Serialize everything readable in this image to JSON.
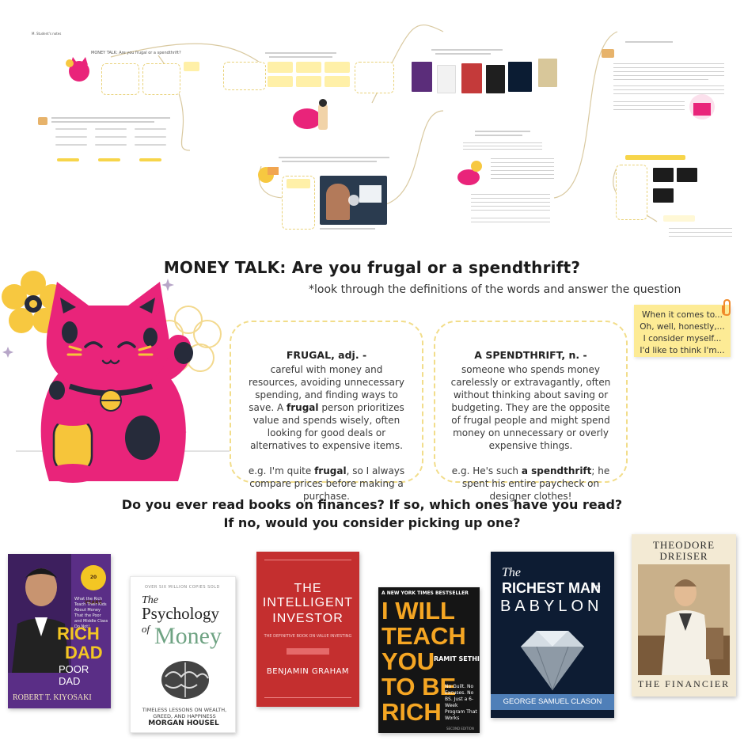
{
  "overview": {
    "header_title": "MONEY TALK: Are you frugal or a spendthrift?",
    "mini_label": "M. Student's notes"
  },
  "main": {
    "title": "MONEY TALK: Are you frugal or a spendthrift?",
    "subtitle": "*look through the definitions of the words and answer the question"
  },
  "definitions": {
    "frugal": {
      "heading": "FRUGAL, adj. -",
      "body_before": "careful with money and resources, avoiding unnecessary spending, and finding ways to save. A ",
      "body_bold": "frugal",
      "body_after": " person prioritizes value and spends wisely, often looking for good deals or alternatives to expensive items.",
      "example_before": "e.g. I'm quite ",
      "example_bold": "frugal",
      "example_after": ", so I always compare prices before making a purchase."
    },
    "spendthrift": {
      "heading": "A SPENDTHRIFT, n. -",
      "body": "someone who spends money carelessly or extravagantly, often without thinking about saving or budgeting. They are the opposite of frugal people and might spend money on unnecessary or overly expensive things.",
      "example_before": "e.g. He's such ",
      "example_bold": "a spendthrift",
      "example_after": "; he spent his entire paycheck on designer clothes!"
    }
  },
  "sticky_note": {
    "lines": [
      "When it comes to...",
      "Oh, well, honestly,...",
      "I consider myself...",
      "I'd like to think I'm..."
    ]
  },
  "question": {
    "line1": "Do you ever read books on finances? If so, which ones have you read?",
    "line2": "If no, would you consider picking up one?"
  },
  "books": [
    {
      "title1": "RICH",
      "title2": "DAD",
      "title3": "POOR DAD",
      "author": "ROBERT T. KIYOSAKI",
      "badge": "20 YEARS",
      "tagline": "What the Rich Teach Their Kids About Money That the Poor and Middle Class Do Not!"
    },
    {
      "kicker": "OVER SIX MILLION COPIES SOLD",
      "title1": "The",
      "title2": "Psychology",
      "title3": "of",
      "title4": "Money",
      "tagline": "TIMELESS LESSONS ON WEALTH, GREED, AND HAPPINESS",
      "author": "MORGAN HOUSEL"
    },
    {
      "title1": "THE",
      "title2": "INTELLIGENT",
      "title3": "INVESTOR",
      "tagline": "THE DEFINITIVE BOOK ON VALUE INVESTING",
      "author": "BENJAMIN GRAHAM"
    },
    {
      "kicker": "A NEW YORK TIMES BESTSELLER",
      "title1": "I WILL",
      "title2": "TEACH",
      "title3": "YOU",
      "title4": "TO BE",
      "title5": "RICH",
      "author": "RAMIT SETHI",
      "tagline": "No Guilt. No Excuses. No BS. Just a 6-Week Program That Works",
      "edition": "SECOND EDITION"
    },
    {
      "title1": "The",
      "title2": "RICHEST MAN",
      "title3": "in",
      "title4": "BABYLON",
      "author": "GEORGE SAMUEL CLASON"
    },
    {
      "title1": "THEODORE",
      "title2": "DREISER",
      "title3": "THE FINANCIER"
    }
  ],
  "colors": {
    "cat_pink": "#e9247a",
    "cat_dark": "#262b3a",
    "cat_yellow": "#f6c53a",
    "flower_yellow": "#f7c840",
    "card_border": "#f2dd8a",
    "sticky": "#fdeb95"
  }
}
